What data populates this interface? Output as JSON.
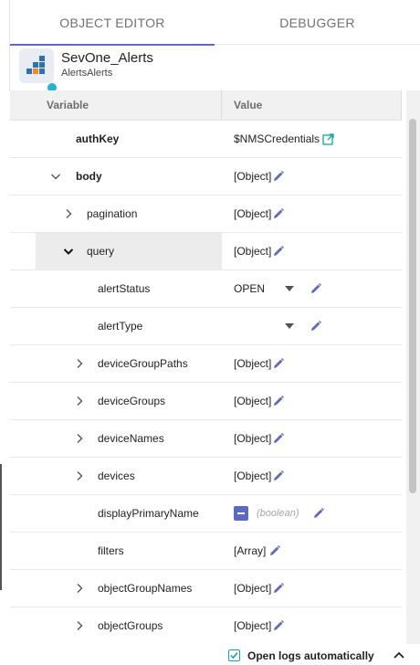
{
  "tabs": [
    {
      "label": "OBJECT EDITOR",
      "active": true
    },
    {
      "label": "DEBUGGER",
      "active": false
    }
  ],
  "header": {
    "title": "SevOne_Alerts",
    "subtitle": "AlertsAlerts",
    "icon": "sevone-logo-icon",
    "status_color": "#21b6d1"
  },
  "table": {
    "col_variable": "Variable",
    "col_value": "Value"
  },
  "rows": [
    {
      "name": "authKey",
      "value": "$NMSCredentials",
      "bold": true,
      "depth": 0,
      "chevron": "none",
      "editor": "link"
    },
    {
      "name": "body",
      "value": "[Object]",
      "bold": true,
      "depth": 0,
      "chevron": "down",
      "editor": "pencil"
    },
    {
      "name": "pagination",
      "value": "[Object]",
      "depth": 1,
      "chevron": "right",
      "editor": "pencil"
    },
    {
      "name": "query",
      "value": "[Object]",
      "depth": 1,
      "chevron": "down",
      "editor": "pencil",
      "highlighted": true
    },
    {
      "name": "alertStatus",
      "value": "OPEN",
      "depth": 2,
      "chevron": "none",
      "editor": "select"
    },
    {
      "name": "alertType",
      "value": "",
      "depth": 2,
      "chevron": "none",
      "editor": "select"
    },
    {
      "name": "deviceGroupPaths",
      "value": "[Object]",
      "depth": 2,
      "chevron": "right",
      "editor": "pencil"
    },
    {
      "name": "deviceGroups",
      "value": "[Object]",
      "depth": 2,
      "chevron": "right",
      "editor": "pencil"
    },
    {
      "name": "deviceNames",
      "value": "[Object]",
      "depth": 2,
      "chevron": "right",
      "editor": "pencil"
    },
    {
      "name": "devices",
      "value": "[Object]",
      "depth": 2,
      "chevron": "right",
      "editor": "pencil"
    },
    {
      "name": "displayPrimaryName",
      "value": "(boolean)",
      "depth": 2,
      "chevron": "none",
      "editor": "boolean"
    },
    {
      "name": "filters",
      "value": "[Array]",
      "depth": 2,
      "chevron": "none",
      "editor": "pencil"
    },
    {
      "name": "objectGroupNames",
      "value": "[Object]",
      "depth": 2,
      "chevron": "right",
      "editor": "pencil"
    },
    {
      "name": "objectGroups",
      "value": "[Object]",
      "depth": 2,
      "chevron": "right",
      "editor": "pencil"
    }
  ],
  "footer": {
    "checkbox_checked": true,
    "label": "Open logs automatically"
  },
  "colors": {
    "accent": "#5c6bc0",
    "teal": "#13a89e",
    "highlight": "#ececec"
  }
}
